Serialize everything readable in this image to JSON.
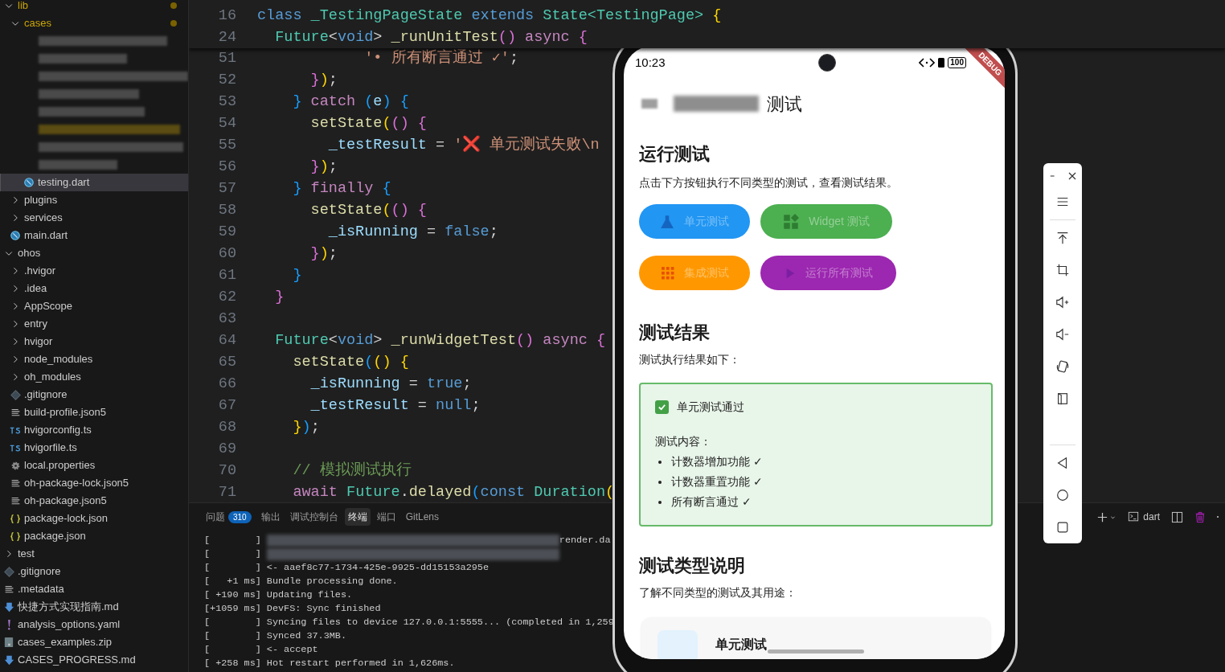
{
  "explorer": {
    "items": [
      {
        "kind": "folder",
        "name": "lib",
        "expanded": true,
        "modified": true,
        "selected": false,
        "children": [
          {
            "kind": "folder",
            "name": "cases",
            "expanded": true,
            "modified": true,
            "selected": false,
            "children": [
              {
                "kind": "redacted",
                "modified": false,
                "selected": false
              },
              {
                "kind": "redacted",
                "modified": false,
                "selected": false
              },
              {
                "kind": "redacted",
                "modified": false,
                "selected": false
              },
              {
                "kind": "redacted",
                "modified": false,
                "selected": false
              },
              {
                "kind": "redacted",
                "modified": false,
                "selected": false
              },
              {
                "kind": "redacted",
                "modified": true,
                "selected": false
              },
              {
                "kind": "redacted",
                "modified": false,
                "selected": false
              },
              {
                "kind": "redacted",
                "modified": false,
                "selected": false
              },
              {
                "kind": "dart",
                "name": "testing.dart",
                "modified": false,
                "selected": true
              }
            ]
          },
          {
            "kind": "folder",
            "name": "plugins",
            "expanded": false,
            "modified": false,
            "selected": false
          },
          {
            "kind": "folder",
            "name": "services",
            "expanded": false,
            "modified": false,
            "selected": false
          },
          {
            "kind": "dart",
            "name": "main.dart",
            "modified": false,
            "selected": false
          }
        ]
      },
      {
        "kind": "folder",
        "name": "ohos",
        "expanded": true,
        "modified": false,
        "selected": false,
        "children": [
          {
            "kind": "folder",
            "name": ".hvigor",
            "expanded": false,
            "modified": false,
            "selected": false
          },
          {
            "kind": "folder",
            "name": ".idea",
            "expanded": false,
            "modified": false,
            "selected": false
          },
          {
            "kind": "folder",
            "name": "AppScope",
            "expanded": false,
            "modified": false,
            "selected": false
          },
          {
            "kind": "folder",
            "name": "entry",
            "expanded": false,
            "modified": false,
            "selected": false
          },
          {
            "kind": "folder",
            "name": "hvigor",
            "expanded": false,
            "modified": false,
            "selected": false
          },
          {
            "kind": "folder",
            "name": "node_modules",
            "expanded": false,
            "modified": false,
            "selected": false
          },
          {
            "kind": "folder",
            "name": "oh_modules",
            "expanded": false,
            "modified": false,
            "selected": false
          },
          {
            "kind": "git",
            "name": ".gitignore",
            "modified": false,
            "selected": false
          },
          {
            "kind": "lines",
            "name": "build-profile.json5",
            "modified": false,
            "selected": false
          },
          {
            "kind": "ts",
            "name": "hvigorconfig.ts",
            "modified": false,
            "selected": false
          },
          {
            "kind": "ts",
            "name": "hvigorfile.ts",
            "modified": false,
            "selected": false
          },
          {
            "kind": "gear",
            "name": "local.properties",
            "modified": false,
            "selected": false
          },
          {
            "kind": "lines",
            "name": "oh-package-lock.json5",
            "modified": false,
            "selected": false
          },
          {
            "kind": "lines",
            "name": "oh-package.json5",
            "modified": false,
            "selected": false
          },
          {
            "kind": "json",
            "name": "package-lock.json",
            "modified": false,
            "selected": false
          },
          {
            "kind": "json",
            "name": "package.json",
            "modified": false,
            "selected": false
          }
        ]
      },
      {
        "kind": "folder",
        "name": "test",
        "expanded": false,
        "modified": false,
        "selected": false
      },
      {
        "kind": "git",
        "name": ".gitignore",
        "modified": false,
        "selected": false
      },
      {
        "kind": "lines",
        "name": ".metadata",
        "modified": false,
        "selected": false
      },
      {
        "kind": "md",
        "name": "快捷方式实现指南.md",
        "modified": false,
        "selected": false
      },
      {
        "kind": "yaml",
        "name": "analysis_options.yaml",
        "modified": false,
        "selected": false
      },
      {
        "kind": "zip",
        "name": "cases_examples.zip",
        "modified": false,
        "selected": false
      },
      {
        "kind": "md",
        "name": "CASES_PROGRESS.md",
        "modified": false,
        "selected": false
      }
    ]
  },
  "editor": {
    "sticky_lines": [
      {
        "number": "16",
        "tokens": [
          {
            "text": "class",
            "kind": "keyword"
          },
          {
            "text": " _TestingPageState",
            "kind": "type"
          },
          {
            "text": " extends",
            "kind": "keyword"
          },
          {
            "text": " State<TestingPage>",
            "kind": "type"
          },
          {
            "text": " {",
            "kind": "bracket1"
          }
        ]
      },
      {
        "number": "24",
        "tokens": [
          {
            "text": "  Future",
            "kind": "type"
          },
          {
            "text": "<",
            "kind": "plain"
          },
          {
            "text": "void",
            "kind": "keyword"
          },
          {
            "text": ">",
            "kind": "plain"
          },
          {
            "text": " _runUnitTest",
            "kind": "function"
          },
          {
            "text": "()",
            "kind": "bracket2"
          },
          {
            "text": " async",
            "kind": "control"
          },
          {
            "text": " {",
            "kind": "bracket2"
          }
        ]
      }
    ],
    "lines": [
      {
        "number": "51",
        "tokens": [
          {
            "text": "            '• 所有断言通过 ✓'",
            "kind": "string"
          },
          {
            "text": ";",
            "kind": "plain"
          }
        ]
      },
      {
        "number": "52",
        "tokens": [
          {
            "text": "      }",
            "kind": "bracket2"
          },
          {
            "text": ")",
            "kind": "bracket1"
          },
          {
            "text": ";",
            "kind": "plain"
          }
        ]
      },
      {
        "number": "53",
        "tokens": [
          {
            "text": "    }",
            "kind": "bracket3"
          },
          {
            "text": " catch",
            "kind": "control"
          },
          {
            "text": " (",
            "kind": "bracket3"
          },
          {
            "text": "e",
            "kind": "variable"
          },
          {
            "text": ")",
            "kind": "bracket3"
          },
          {
            "text": " {",
            "kind": "bracket3"
          }
        ]
      },
      {
        "number": "54",
        "tokens": [
          {
            "text": "      setState",
            "kind": "function"
          },
          {
            "text": "(",
            "kind": "bracket1"
          },
          {
            "text": "()",
            "kind": "bracket2"
          },
          {
            "text": " {",
            "kind": "bracket2"
          }
        ]
      },
      {
        "number": "55",
        "tokens": [
          {
            "text": "        _testResult",
            "kind": "variable"
          },
          {
            "text": " =",
            "kind": "plain"
          },
          {
            "text": " '❌ 单元测试失败\\n",
            "kind": "string"
          }
        ]
      },
      {
        "number": "56",
        "tokens": [
          {
            "text": "      }",
            "kind": "bracket2"
          },
          {
            "text": ")",
            "kind": "bracket1"
          },
          {
            "text": ";",
            "kind": "plain"
          }
        ]
      },
      {
        "number": "57",
        "tokens": [
          {
            "text": "    }",
            "kind": "bracket3"
          },
          {
            "text": " finally",
            "kind": "control"
          },
          {
            "text": " {",
            "kind": "bracket3"
          }
        ]
      },
      {
        "number": "58",
        "tokens": [
          {
            "text": "      setState",
            "kind": "function"
          },
          {
            "text": "(",
            "kind": "bracket1"
          },
          {
            "text": "()",
            "kind": "bracket2"
          },
          {
            "text": " {",
            "kind": "bracket2"
          }
        ]
      },
      {
        "number": "59",
        "tokens": [
          {
            "text": "        _isRunning",
            "kind": "variable"
          },
          {
            "text": " =",
            "kind": "plain"
          },
          {
            "text": " false",
            "kind": "keyword"
          },
          {
            "text": ";",
            "kind": "plain"
          }
        ]
      },
      {
        "number": "60",
        "tokens": [
          {
            "text": "      }",
            "kind": "bracket2"
          },
          {
            "text": ")",
            "kind": "bracket1"
          },
          {
            "text": ";",
            "kind": "plain"
          }
        ]
      },
      {
        "number": "61",
        "tokens": [
          {
            "text": "    }",
            "kind": "bracket3"
          }
        ]
      },
      {
        "number": "62",
        "tokens": [
          {
            "text": "  }",
            "kind": "bracket2"
          }
        ]
      },
      {
        "number": "63"
      },
      {
        "number": "64",
        "tokens": [
          {
            "text": "  Future",
            "kind": "type"
          },
          {
            "text": "<",
            "kind": "plain"
          },
          {
            "text": "void",
            "kind": "keyword"
          },
          {
            "text": ">",
            "kind": "plain"
          },
          {
            "text": " _runWidgetTest",
            "kind": "function"
          },
          {
            "text": "()",
            "kind": "bracket2"
          },
          {
            "text": " async",
            "kind": "control"
          },
          {
            "text": " {",
            "kind": "bracket2"
          }
        ]
      },
      {
        "number": "65",
        "tokens": [
          {
            "text": "    setState",
            "kind": "function"
          },
          {
            "text": "(",
            "kind": "bracket3"
          },
          {
            "text": "()",
            "kind": "bracket1"
          },
          {
            "text": " {",
            "kind": "bracket1"
          }
        ]
      },
      {
        "number": "66",
        "tokens": [
          {
            "text": "      _isRunning",
            "kind": "variable"
          },
          {
            "text": " =",
            "kind": "plain"
          },
          {
            "text": " true",
            "kind": "keyword"
          },
          {
            "text": ";",
            "kind": "plain"
          }
        ]
      },
      {
        "number": "67",
        "tokens": [
          {
            "text": "      _testResult",
            "kind": "variable"
          },
          {
            "text": " =",
            "kind": "plain"
          },
          {
            "text": " null",
            "kind": "keyword"
          },
          {
            "text": ";",
            "kind": "plain"
          }
        ]
      },
      {
        "number": "68",
        "tokens": [
          {
            "text": "    }",
            "kind": "bracket1"
          },
          {
            "text": ")",
            "kind": "bracket3"
          },
          {
            "text": ";",
            "kind": "plain"
          }
        ]
      },
      {
        "number": "69"
      },
      {
        "number": "70",
        "tokens": [
          {
            "text": "    // 模拟测试执行",
            "kind": "comment"
          }
        ]
      },
      {
        "number": "71",
        "tokens": [
          {
            "text": "    await",
            "kind": "control"
          },
          {
            "text": " Future",
            "kind": "type"
          },
          {
            "text": ".",
            "kind": "plain"
          },
          {
            "text": "delayed",
            "kind": "function"
          },
          {
            "text": "(",
            "kind": "bracket3"
          },
          {
            "text": "const",
            "kind": "keyword"
          },
          {
            "text": " Duration",
            "kind": "type"
          },
          {
            "text": "(",
            "kind": "bracket1"
          }
        ]
      }
    ]
  },
  "panel": {
    "tabs": [
      {
        "label": "问题",
        "badge": "310",
        "selected": false
      },
      {
        "label": "输出",
        "selected": false
      },
      {
        "label": "调试控制台",
        "selected": false
      },
      {
        "label": "终端",
        "selected": true
      },
      {
        "label": "端口",
        "selected": false
      },
      {
        "label": "GitLens",
        "selected": false
      }
    ],
    "terminal_name": "dart",
    "terminal_lines": [
      {
        "kind": "redacted",
        "text": "[        ]",
        "tail": "render.da"
      },
      {
        "kind": "redacted",
        "text": "[        ]"
      },
      {
        "kind": "log",
        "text": "[        ] <- aaef8c77-1734-425e-9925-dd15153a295e"
      },
      {
        "kind": "log",
        "text": "[   +1 ms] Bundle processing done."
      },
      {
        "kind": "log",
        "text": "[ +190 ms] Updating files."
      },
      {
        "kind": "log",
        "text": "[+1059 ms] DevFS: Sync finished"
      },
      {
        "kind": "log",
        "text": "[        ] Syncing files to device 127.0.0.1:5555... (completed in 1,259"
      },
      {
        "kind": "log",
        "text": "[        ] Synced 37.3MB."
      },
      {
        "kind": "log",
        "text": "[        ] <- accept"
      },
      {
        "kind": "log",
        "text": "[ +258 ms] Hot restart performed in 1,626ms."
      }
    ]
  },
  "phone": {
    "status_bar": {
      "time": "10:23",
      "battery": "100"
    },
    "debug_banner": "DEBUG",
    "app_bar": {
      "title": "测试"
    },
    "run_section": {
      "heading": "运行测试",
      "description": "点击下方按钮执行不同类型的测试，查看测试结果。",
      "buttons": [
        {
          "label": "单元测试",
          "color": "#2196f3",
          "disabled": true
        },
        {
          "label": "Widget 测试",
          "color": "#4caf50",
          "disabled": true
        },
        {
          "label": "集成测试",
          "color": "#ff9800",
          "disabled": true
        },
        {
          "label": "运行所有测试",
          "color": "#9c27b0",
          "disabled": true
        }
      ]
    },
    "result_section": {
      "heading": "测试结果",
      "description": "测试执行结果如下：",
      "result": {
        "checked": true,
        "title": "单元测试通过",
        "subtitle": "测试内容：",
        "items": [
          "计数器增加功能 ✓",
          "计数器重置功能 ✓",
          "所有断言通过 ✓"
        ]
      }
    },
    "types_section": {
      "heading": "测试类型说明",
      "description": "了解不同类型的测试及其用途：",
      "cards": [
        {
          "title": "单元测试"
        }
      ]
    }
  }
}
